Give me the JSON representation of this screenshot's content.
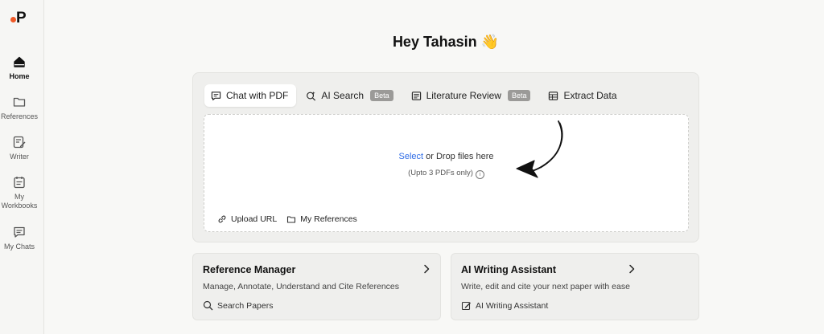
{
  "logo": {
    "letter": "P",
    "accent": "#f05a28"
  },
  "sidebar": {
    "items": [
      {
        "label": "Home",
        "icon": "home-icon",
        "active": true
      },
      {
        "label": "References",
        "icon": "folder-icon"
      },
      {
        "label": "Writer",
        "icon": "pen-note-icon"
      },
      {
        "label": "My Workbooks",
        "icon": "clipboard-icon"
      },
      {
        "label": "My Chats",
        "icon": "chat-icon"
      }
    ]
  },
  "greeting": {
    "text": "Hey Tahasin 👋"
  },
  "tabs": [
    {
      "label": "Chat with PDF",
      "icon": "chat-icon",
      "active": true
    },
    {
      "label": "AI Search",
      "icon": "search-sparkle-icon",
      "badge": "Beta"
    },
    {
      "label": "Literature Review",
      "icon": "list-icon",
      "badge": "Beta"
    },
    {
      "label": "Extract Data",
      "icon": "table-icon"
    }
  ],
  "dropzone": {
    "select_label": "Select",
    "drop_text": " or Drop files here",
    "limit_text": "(Upto 3 PDFs only)",
    "info_icon": "info-icon"
  },
  "drop_actions": {
    "upload_url": "Upload URL",
    "my_references": "My References"
  },
  "cards": [
    {
      "title": "Reference Manager",
      "description": "Manage, Annotate, Understand and Cite References",
      "link_label": "Search Papers",
      "link_icon": "search-icon"
    },
    {
      "title": "AI Writing Assistant",
      "description": "Write, edit and cite your next paper with ease",
      "link_label": "AI Writing Assistant",
      "link_icon": "edit-icon"
    }
  ],
  "colors": {
    "link_blue": "#2e6be6",
    "badge_gray": "#9b9a98",
    "panel": "#efefed"
  }
}
